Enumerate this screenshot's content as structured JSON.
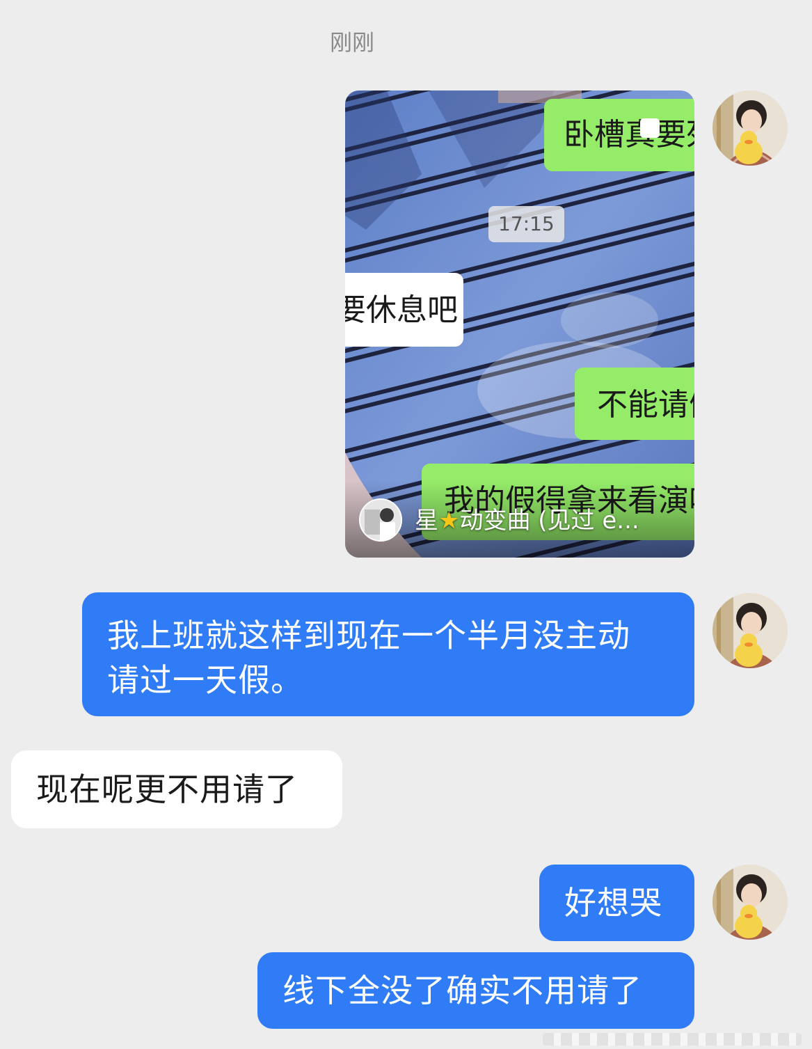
{
  "timestamp": "刚刚",
  "card": {
    "chat_lines": {
      "line1": "卧槽真要死",
      "time": "17:15",
      "line2": "要休息吧",
      "line3": "不能请假",
      "line4": "我的假得拿来看演唱"
    },
    "author_prefix": "星",
    "author_suffix": "动变曲 (见过 e..."
  },
  "messages": [
    {
      "side": "self",
      "text_line1": "我上班就这样到现在一个半月没主动",
      "text_line2": "请过一天假。"
    },
    {
      "side": "other",
      "text": "现在呢更不用请了"
    },
    {
      "side": "self",
      "text": "好想哭"
    },
    {
      "side": "self",
      "text": "线下全没了确实不用请了"
    }
  ],
  "colors": {
    "background": "#ededed",
    "self_bubble": "#2f7cf6",
    "other_bubble": "#ffffff",
    "wechat_green": "#95ec69"
  },
  "icons": [
    "avatar-duck-plush",
    "star-emoji"
  ]
}
